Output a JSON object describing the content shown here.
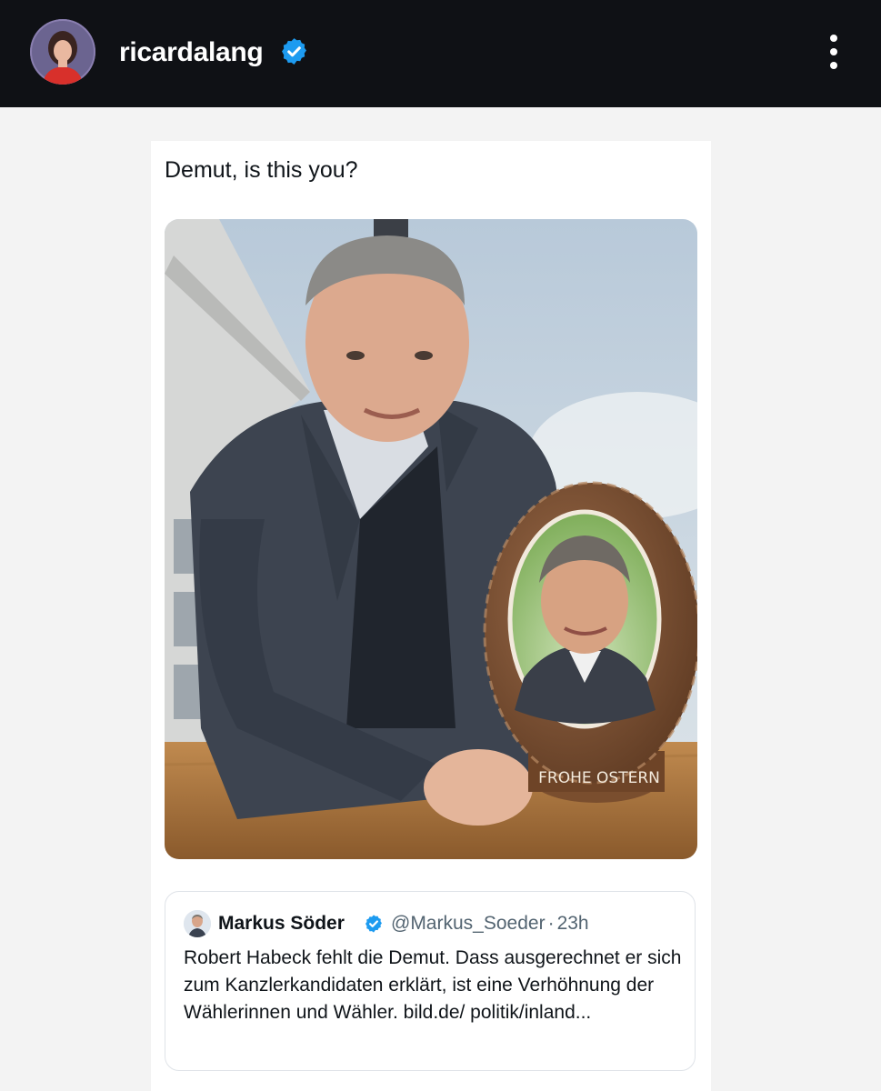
{
  "header": {
    "username": "ricardalang",
    "avatar_icon": "profile-photo",
    "verified_icon": "verified-badge-icon",
    "menu_icon": "more-vertical-icon"
  },
  "post": {
    "caption": "Demut, is this you?",
    "image": {
      "egg_inscription": "FROHE OSTERN"
    },
    "quoted_tweet": {
      "display_name": "Markus Söder",
      "handle": "@Markus_Soeder",
      "separator": "·",
      "time": "23h",
      "text": "Robert Habeck fehlt die Demut. Dass ausgerechnet er sich zum Kanzlerkandidaten erklärt, ist eine Verhöhnung der Wählerinnen und Wähler.  bild.de/ politik/inland..."
    }
  },
  "colors": {
    "topbar": "#0f1115",
    "verified": "#1d9bf0",
    "muted_text": "#536471"
  }
}
